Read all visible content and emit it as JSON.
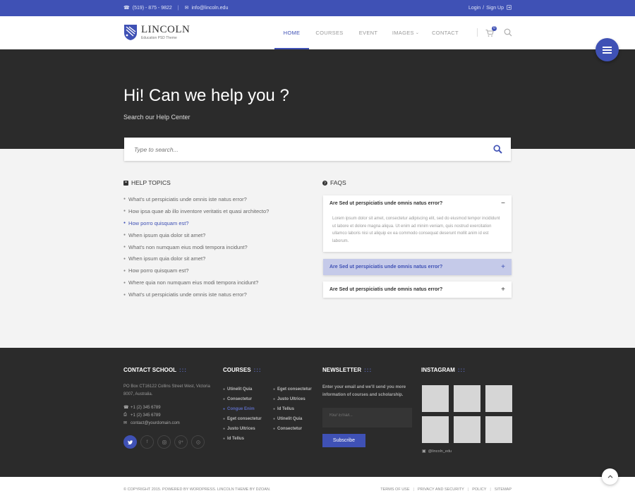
{
  "topbar": {
    "phone": "(519) - 875 - 9822",
    "email": "info@lincoln.edu",
    "login": "Login",
    "slash": "/",
    "signup": "Sign Up"
  },
  "brand": {
    "name": "LINCOLN",
    "tagline": "Education PSD Theme"
  },
  "nav": {
    "items": [
      {
        "label": "HOME",
        "active": true
      },
      {
        "label": "COURSES"
      },
      {
        "label": "EVENT"
      },
      {
        "label": "IMAGES"
      },
      {
        "label": "CONTACT"
      }
    ],
    "cart_count": "0"
  },
  "hero": {
    "title": "Hi! Can we help you ?",
    "subtitle": "Search our Help Center"
  },
  "search": {
    "placeholder": "Type to search..."
  },
  "help_topics": {
    "title": "HELP TOPICS",
    "items": [
      "What's ut perspiciatis unde omnis iste natus error?",
      "How ipsa quae ab illo inventore veritatis et quasi architecto?",
      "How porro quisquam est?",
      "When ipsum quia dolor sit amet?",
      "What's non numquam eius modi tempora incidunt?",
      "When ipsum quia dolor sit amet?",
      "How porro quisquam est?",
      "Where quia non numquam eius modi tempora incidunt?",
      "What's ut perspiciatis unde omnis iste natus error?"
    ],
    "active_index": 2
  },
  "faqs": {
    "title": "FAQS",
    "items": [
      {
        "question": "Are Sed ut perspiciatis unde omnis natus error?",
        "toggle": "−",
        "answer": "Lorem ipsum dolor sit amet, consectetur adipiscing elit, sed do eiusmod tempor incididunt ut labore et dolore magna aliqua. Ut enim ad minim veniam, quis nostrud exercitation ullamco laboris nisi ut aliquip ex ea commodo consequat deserunt mollit anim id est laborum."
      },
      {
        "question": "Are Sed ut perspiciatis unde omnis natus error?",
        "toggle": "+"
      },
      {
        "question": "Are Sed ut perspiciatis unde omnis natus error?",
        "toggle": "+"
      }
    ]
  },
  "footer": {
    "contact": {
      "title": "CONTACT SCHOOL",
      "dots": ":::",
      "address": "PO Box CT16122 Collins Street West, Victoria 8007, Australia.",
      "phone": "+1 (2) 345 6789",
      "fax": "+1 (2) 345 6789",
      "email": "contact@yourdomain.com"
    },
    "courses": {
      "title": "COURSES",
      "dots": ":::",
      "col1": [
        "Utinelit Quia",
        "Consectetur",
        "Congue Enim",
        "Eget consectetur",
        "Justo Ultrices",
        "Id Tellus"
      ],
      "col2": [
        "Eget consectetur",
        "Justo Ultrices",
        "Id Tellus",
        "Utinelit Quia",
        "Consectetur"
      ],
      "active": "Congue Enim"
    },
    "newsletter": {
      "title": "NEWSLETTER",
      "dots": ":::",
      "text": "Enter your email and we'll send you more information of courses and scholarship.",
      "placeholder": "Your Email...",
      "button": "Subscribe"
    },
    "instagram": {
      "title": "INSTAGRAM",
      "dots": ":::",
      "handle": "@lincoln_edu"
    }
  },
  "bottom": {
    "copyright": "© COPYRIGHT 2015. POWERED BY WORDPRESS. LINCOLN THEME BY DZOAN.",
    "links": [
      "TERMS OF USE",
      "PRIVACY AND SECURITY",
      "POLICY",
      "SITEMAP"
    ]
  },
  "colors": {
    "primary": "#3f51b5",
    "dark": "#2b2b2b",
    "highlight": "#c5cae9"
  }
}
